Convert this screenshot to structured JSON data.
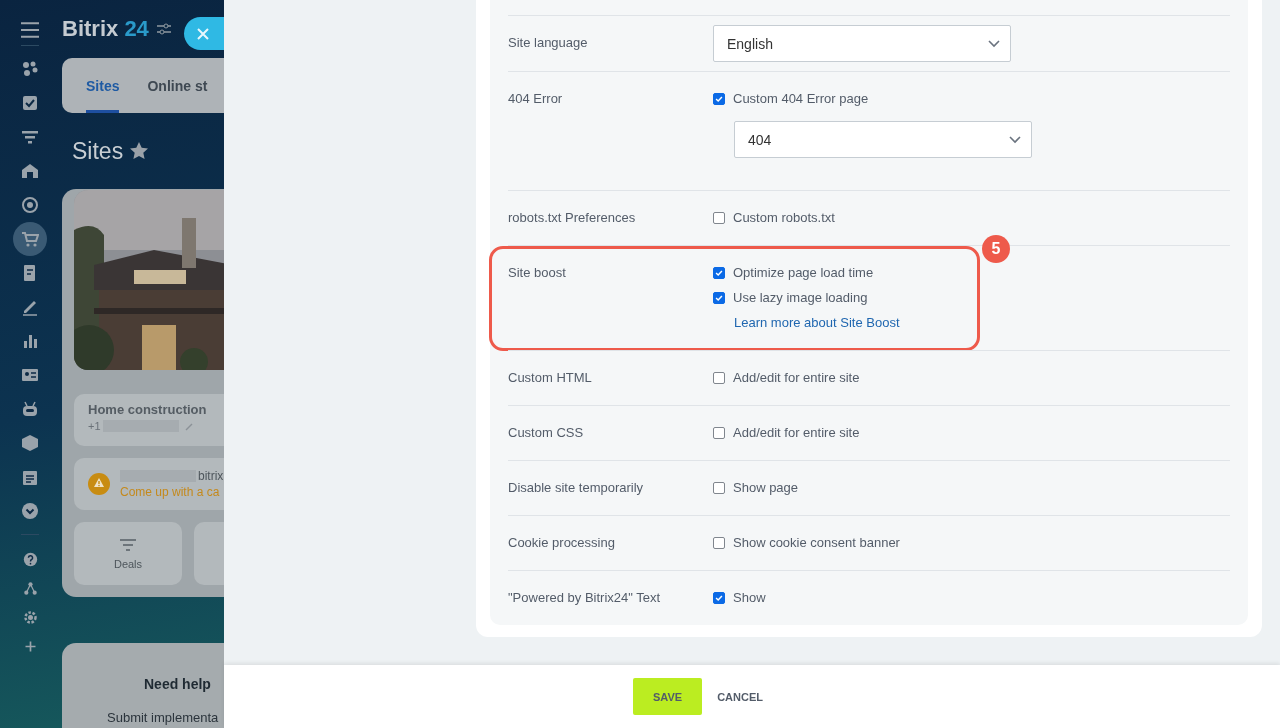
{
  "left_page": {
    "logo": {
      "name": "Bitrix",
      "number": "24"
    },
    "tabs": [
      {
        "label": "Sites",
        "selected": true
      },
      {
        "label": "Online st",
        "selected": false
      }
    ],
    "title": "Sites",
    "site_card": {
      "name": "Home construction",
      "phone": "+1",
      "domain": "bitrix",
      "warning": "Come up with a ca",
      "actions": [
        "Deals"
      ]
    },
    "help": {
      "title": "Need help",
      "text": "Submit implementa"
    }
  },
  "sidebar": {
    "items": [
      {
        "selected": false
      },
      {
        "selected": false
      },
      {
        "selected": false
      },
      {
        "selected": false
      },
      {
        "selected": false
      },
      {
        "selected": true
      },
      {
        "selected": false
      },
      {
        "selected": false
      },
      {
        "selected": false
      },
      {
        "selected": false
      },
      {
        "selected": false
      },
      {
        "selected": false
      },
      {
        "selected": false
      },
      {
        "selected": false
      }
    ]
  },
  "settings": [
    {
      "label": "Site language",
      "controls": [
        {
          "kind": "select",
          "value": "English"
        }
      ]
    },
    {
      "label": "404 Error",
      "controls": [
        {
          "kind": "checkbox",
          "label": "Custom 404 Error page",
          "checked": true
        },
        {
          "kind": "select",
          "value": "404"
        }
      ]
    },
    {
      "label": "robots.txt Preferences",
      "controls": [
        {
          "kind": "checkbox",
          "label": "Custom robots.txt",
          "checked": false
        }
      ]
    },
    {
      "label": "Site boost",
      "highlighted": true,
      "callout": "5",
      "controls": [
        {
          "kind": "checkbox",
          "label": "Optimize page load time",
          "checked": true
        },
        {
          "kind": "checkbox",
          "label": "Use lazy image loading",
          "checked": true
        },
        {
          "kind": "link",
          "text": "Learn more about Site Boost"
        }
      ]
    },
    {
      "label": "Custom HTML",
      "controls": [
        {
          "kind": "checkbox",
          "label": "Add/edit for entire site",
          "checked": false
        }
      ]
    },
    {
      "label": "Custom CSS",
      "controls": [
        {
          "kind": "checkbox",
          "label": "Add/edit for entire site",
          "checked": false
        }
      ]
    },
    {
      "label": "Disable site temporarily",
      "controls": [
        {
          "kind": "checkbox",
          "label": "Show page",
          "checked": false
        }
      ]
    },
    {
      "label": "Cookie processing",
      "controls": [
        {
          "kind": "checkbox",
          "label": "Show cookie consent banner",
          "checked": false
        }
      ]
    },
    {
      "label": "\"Powered by Bitrix24\" Text",
      "controls": [
        {
          "kind": "checkbox",
          "label": "Show",
          "checked": true
        }
      ]
    }
  ],
  "footer": {
    "buttons": [
      "SAVE",
      "CANCEL"
    ]
  }
}
